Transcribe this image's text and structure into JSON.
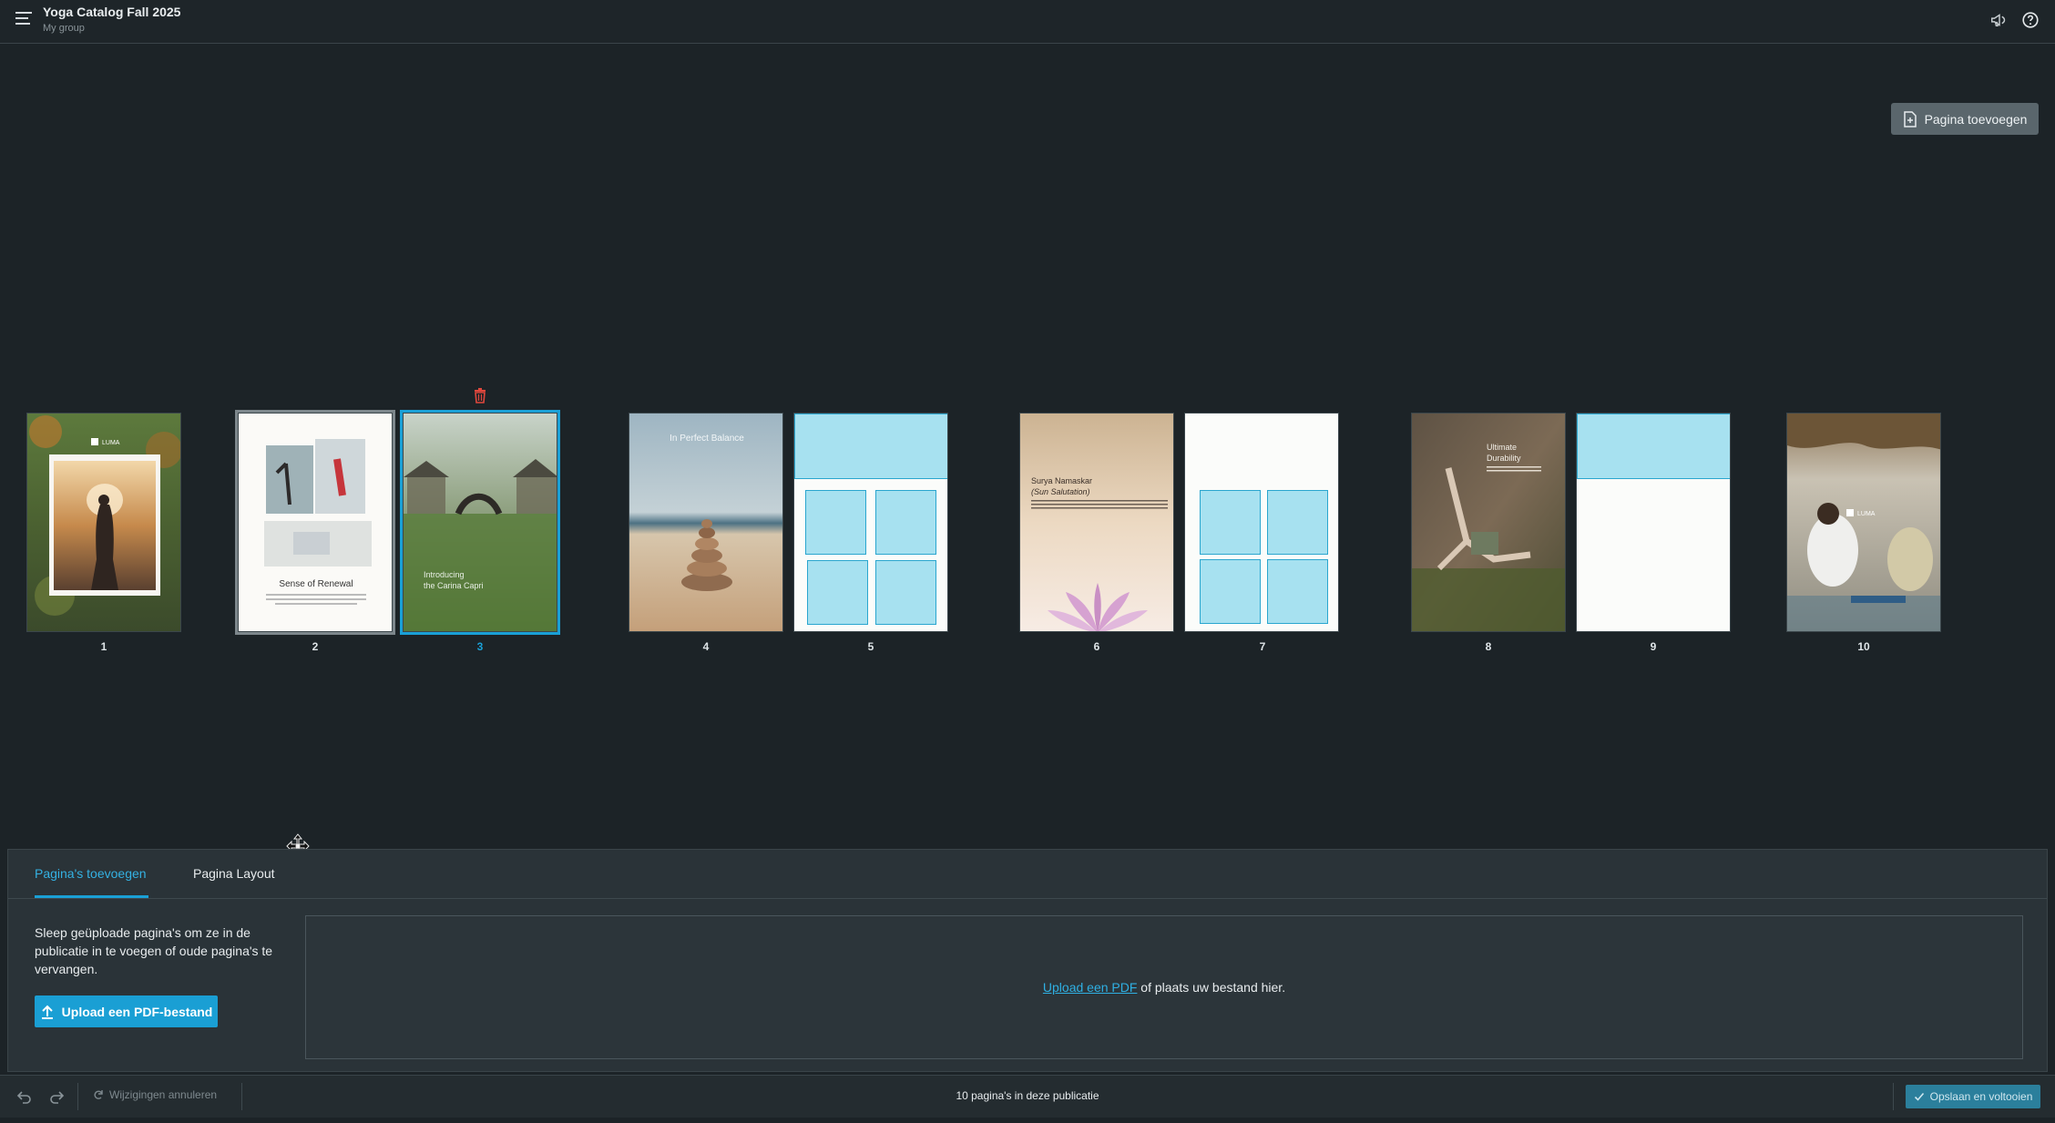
{
  "header": {
    "title": "Yoga Catalog Fall 2025",
    "subtitle": "My group"
  },
  "toolbar": {
    "add_page_label": "Pagina toevoegen"
  },
  "pages": {
    "p1": {
      "number": "1",
      "brand": "LUMA"
    },
    "p2": {
      "number": "2",
      "headline": "Sense of Renewal"
    },
    "p3": {
      "number": "3",
      "headline_line1": "Introducing",
      "headline_line2": "the Carina Capri"
    },
    "p4": {
      "number": "4",
      "headline": "In Perfect Balance"
    },
    "p5": {
      "number": "5"
    },
    "p6": {
      "number": "6",
      "headline": "Surya Namaskar",
      "subheadline": "(Sun Salutation)"
    },
    "p7": {
      "number": "7"
    },
    "p8": {
      "number": "8",
      "headline_line1": "Ultimate",
      "headline_line2": "Durability"
    },
    "p9": {
      "number": "9"
    },
    "p10": {
      "number": "10",
      "brand": "LUMA"
    }
  },
  "panel": {
    "tab_add_pages": "Pagina's toevoegen",
    "tab_page_layout": "Pagina Layout",
    "help_text": "Sleep geüploade pagina's om ze in de publicatie in te voegen of oude pagina's te vervangen.",
    "upload_button": "Upload een PDF-bestand",
    "dropzone_link": "Upload een PDF",
    "dropzone_text": " of plaats uw bestand hier."
  },
  "statusbar": {
    "cancel_changes": "Wijzigingen annuleren",
    "page_count": "10 pagina's in deze publicatie",
    "save_button": "Opslaan en voltooien"
  },
  "colors": {
    "accent": "#1aa0d6",
    "placeholder_fill": "#a7e1f0",
    "delete_red": "#e0473d"
  }
}
